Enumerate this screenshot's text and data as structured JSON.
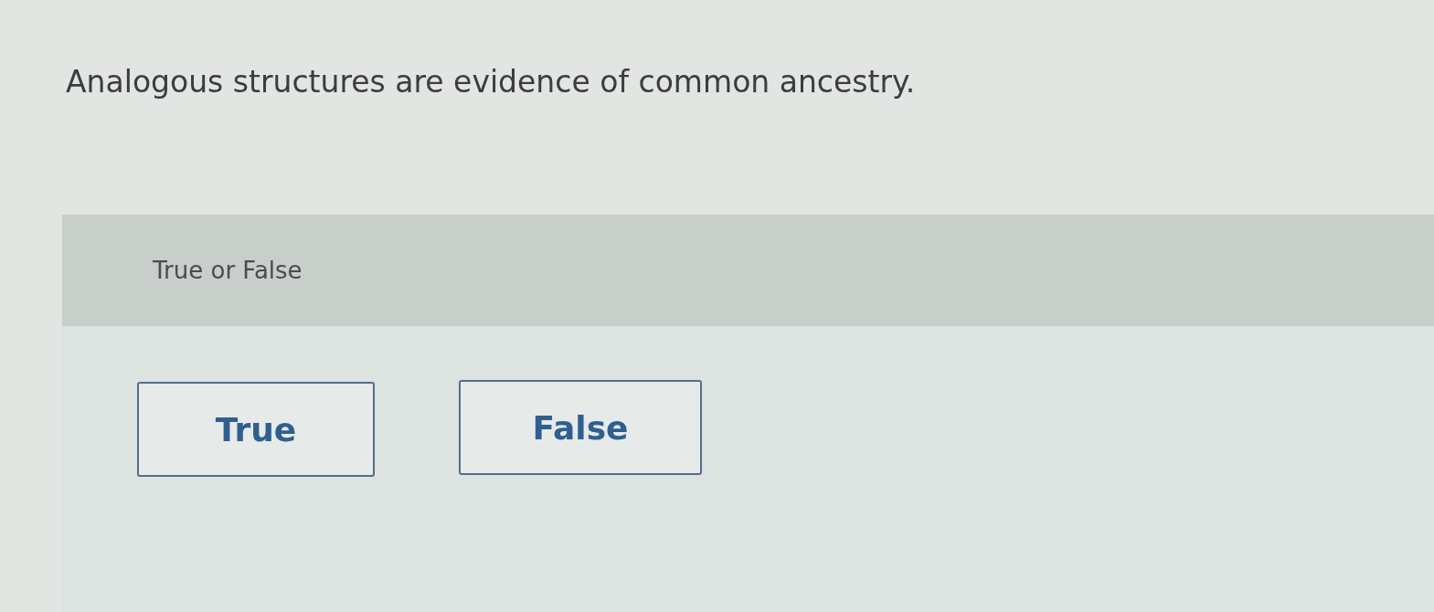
{
  "question": {
    "text": "Analogous structures are evidence of common ancestry."
  },
  "answer_panel": {
    "heading": "True or False",
    "options": [
      {
        "label": "True",
        "selected": false
      },
      {
        "label": "False",
        "selected": false
      }
    ]
  }
}
